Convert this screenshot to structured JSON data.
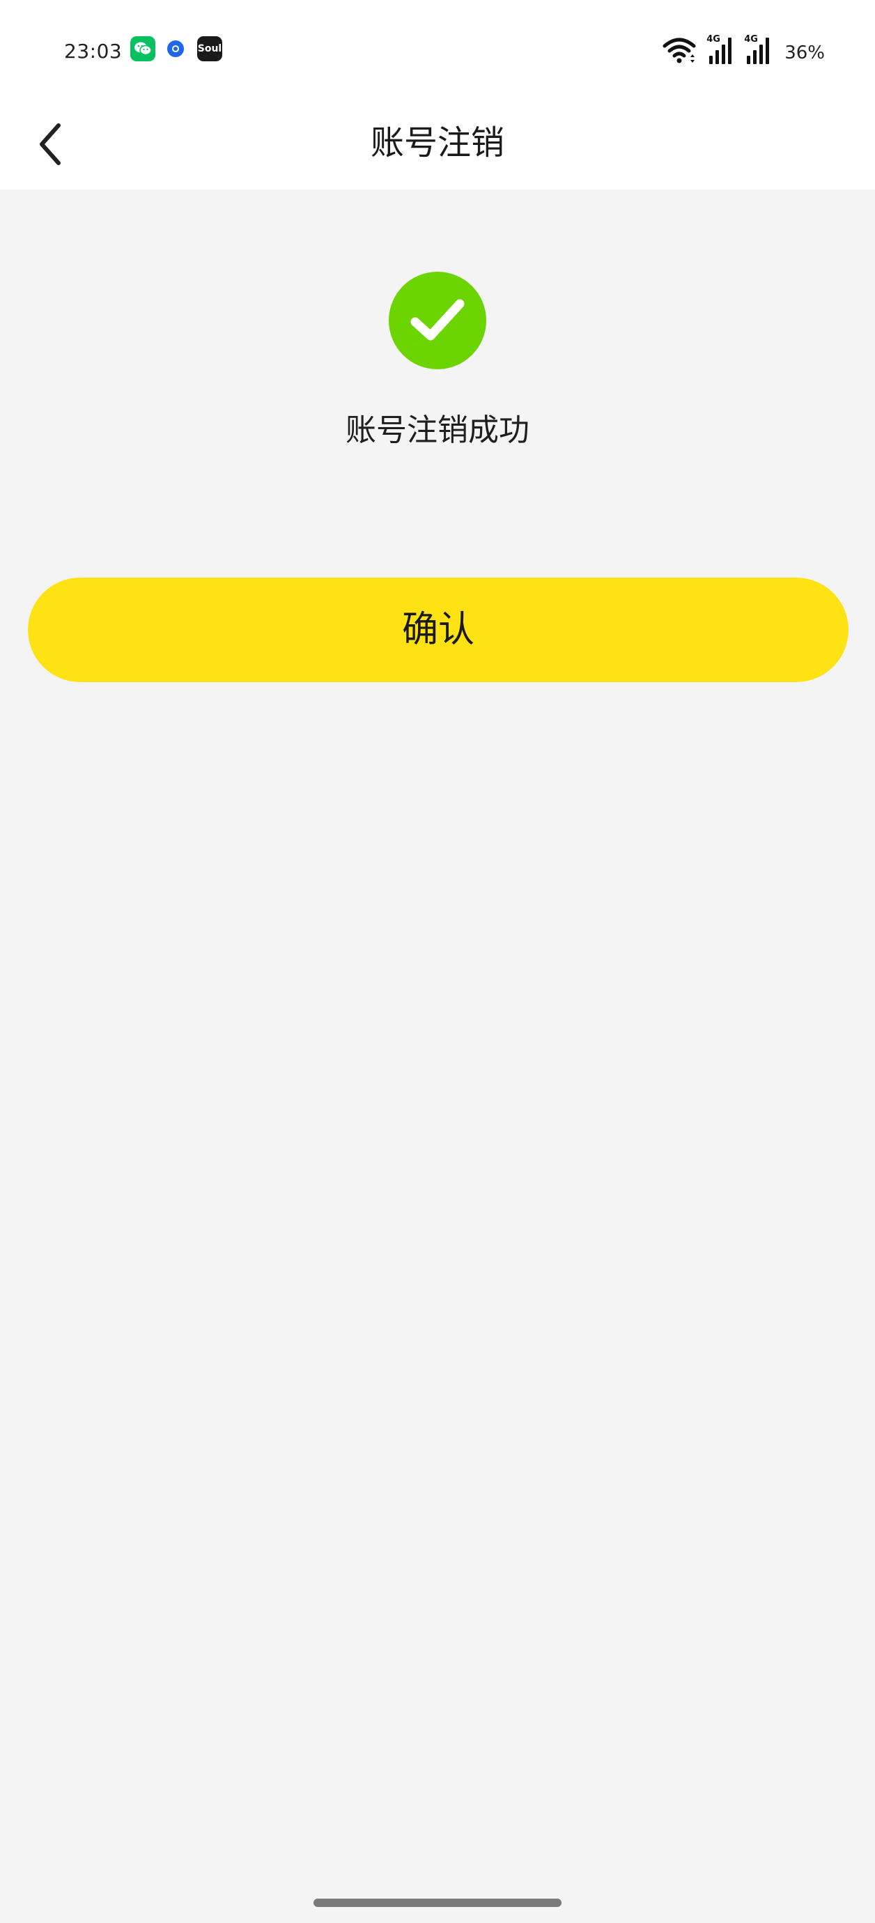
{
  "status_bar": {
    "time": "23:03",
    "notification_icons": [
      "wechat-icon",
      "blue-circle-icon",
      "soul-app-icon"
    ],
    "soul_icon_text": "Soul",
    "network_1": "4G",
    "network_2": "4G",
    "battery": "36%"
  },
  "nav": {
    "title": "账号注销"
  },
  "main": {
    "success_message": "账号注销成功",
    "confirm_label": "确认"
  },
  "colors": {
    "accent_yellow": "#ffe213",
    "success_green": "#6cd400",
    "background": "#f4f4f4"
  }
}
